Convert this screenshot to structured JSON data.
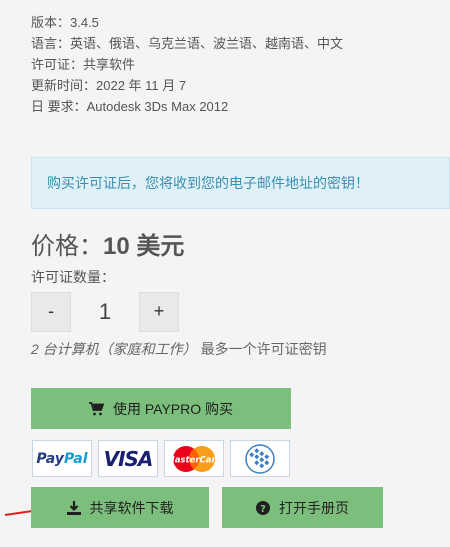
{
  "info": {
    "version": "版本：3.4.5",
    "languages": "语言：英语、俄语、乌克兰语、波兰语、越南语、中文",
    "license": "许可证：共享软件",
    "updated": "更新时间：2022 年 11 月 7",
    "requirements": "日 要求：Autodesk 3Ds Max 2012"
  },
  "notice": "购买许可证后，您将收到您的电子邮件地址的密钥！",
  "price": {
    "label": "价格：",
    "value": "10 美元"
  },
  "quantity": {
    "label": "许可证数量：",
    "minus": "-",
    "value": "1",
    "plus": "+",
    "note_italic": "2 台计算机（家庭和工作）",
    "note_rest": " 最多一个许可证密钥"
  },
  "buttons": {
    "buy": "使用 PAYPRO 购买",
    "download": "共享软件下载",
    "manual": "打开手册页"
  },
  "payment": {
    "paypal_a": "Pay",
    "paypal_b": "Pal",
    "visa": "VISA",
    "mastercard": "MasterCard"
  },
  "colors": {
    "button_green": "#7cbf7c",
    "notice_bg": "#dff1f7",
    "notice_text": "#3a8fb0",
    "arrow_red": "#e02020"
  }
}
